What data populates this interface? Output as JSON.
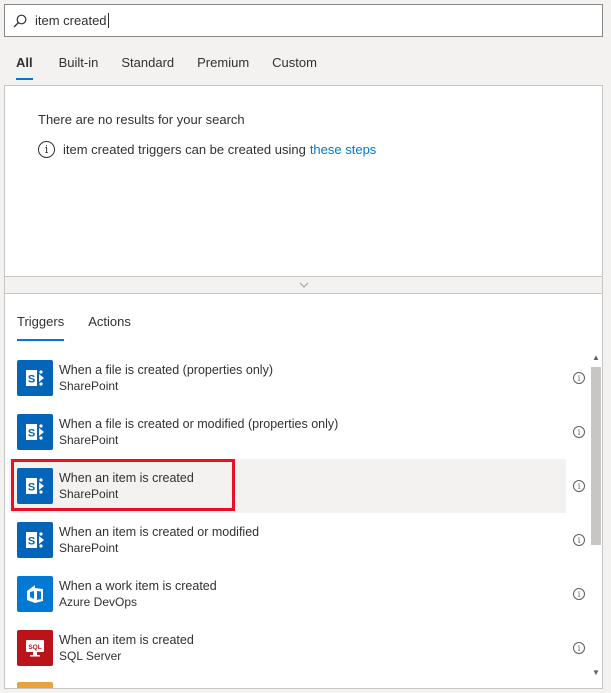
{
  "search": {
    "value": "item created"
  },
  "tabs": [
    {
      "label": "All",
      "active": true
    },
    {
      "label": "Built-in"
    },
    {
      "label": "Standard"
    },
    {
      "label": "Premium"
    },
    {
      "label": "Custom"
    }
  ],
  "results": {
    "no_results": "There are no results for your search",
    "hint_prefix": "item created triggers can be created using",
    "hint_link": "these steps"
  },
  "subtabs": [
    {
      "label": "Triggers",
      "active": true
    },
    {
      "label": "Actions"
    }
  ],
  "items": [
    {
      "title": "When a file is created (properties only)",
      "connector": "SharePoint",
      "icon": "sharepoint-icon",
      "color": "#0364b8"
    },
    {
      "title": "When a file is created or modified (properties only)",
      "connector": "SharePoint",
      "icon": "sharepoint-icon",
      "color": "#0364b8"
    },
    {
      "title": "When an item is created",
      "connector": "SharePoint",
      "icon": "sharepoint-icon",
      "color": "#0364b8"
    },
    {
      "title": "When an item is created or modified",
      "connector": "SharePoint",
      "icon": "sharepoint-icon",
      "color": "#0364b8"
    },
    {
      "title": "When a work item is created",
      "connector": "Azure DevOps",
      "icon": "azure-devops-icon",
      "color": "#0078d4"
    },
    {
      "title": "When an item is created",
      "connector": "SQL Server",
      "icon": "sql-server-icon",
      "color": "#ba141a"
    }
  ],
  "icons": {
    "sql_label": "SQL"
  },
  "colors": {
    "accent": "#0078d4",
    "highlight": "#e81123",
    "partial_icon": "#e8a33a"
  }
}
